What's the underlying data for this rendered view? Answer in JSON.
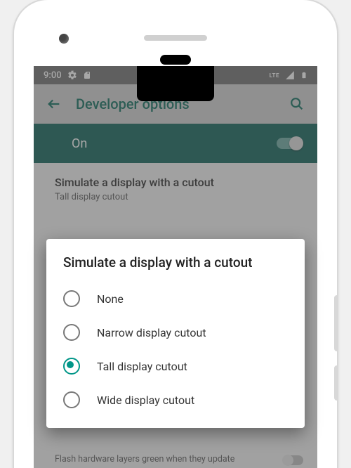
{
  "status": {
    "time": "9:00",
    "lte_label": "LTE"
  },
  "toolbar": {
    "title": "Developer options"
  },
  "master": {
    "label": "On",
    "enabled": true
  },
  "setting": {
    "title": "Simulate a display with a cutout",
    "value": "Tall display cutout"
  },
  "dialog": {
    "title": "Simulate a display with a cutout",
    "options": [
      {
        "label": "None",
        "selected": false
      },
      {
        "label": "Narrow display cutout",
        "selected": false
      },
      {
        "label": "Tall display cutout",
        "selected": true
      },
      {
        "label": "Wide display cutout",
        "selected": false
      }
    ]
  },
  "footer": {
    "text": "Flash hardware layers green when they update"
  },
  "colors": {
    "accent": "#009688",
    "teal_dark": "#0d6057"
  }
}
